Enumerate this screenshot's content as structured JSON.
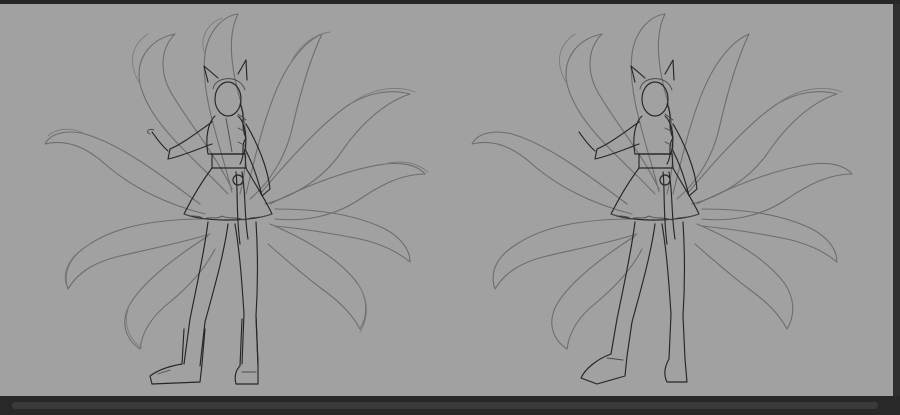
{
  "app": {
    "accent_canvas": "#a1a1a1",
    "chrome_color": "#2b2b2b"
  },
  "artboard": {
    "drawings": [
      {
        "name": "nine-tailed-fox-girl-rough-sketch",
        "stage": "rough"
      },
      {
        "name": "nine-tailed-fox-girl-refined-lineart",
        "stage": "lineart"
      }
    ]
  },
  "scrollbars": {
    "horizontal": {
      "visible": true
    },
    "vertical": {
      "visible": true
    }
  }
}
